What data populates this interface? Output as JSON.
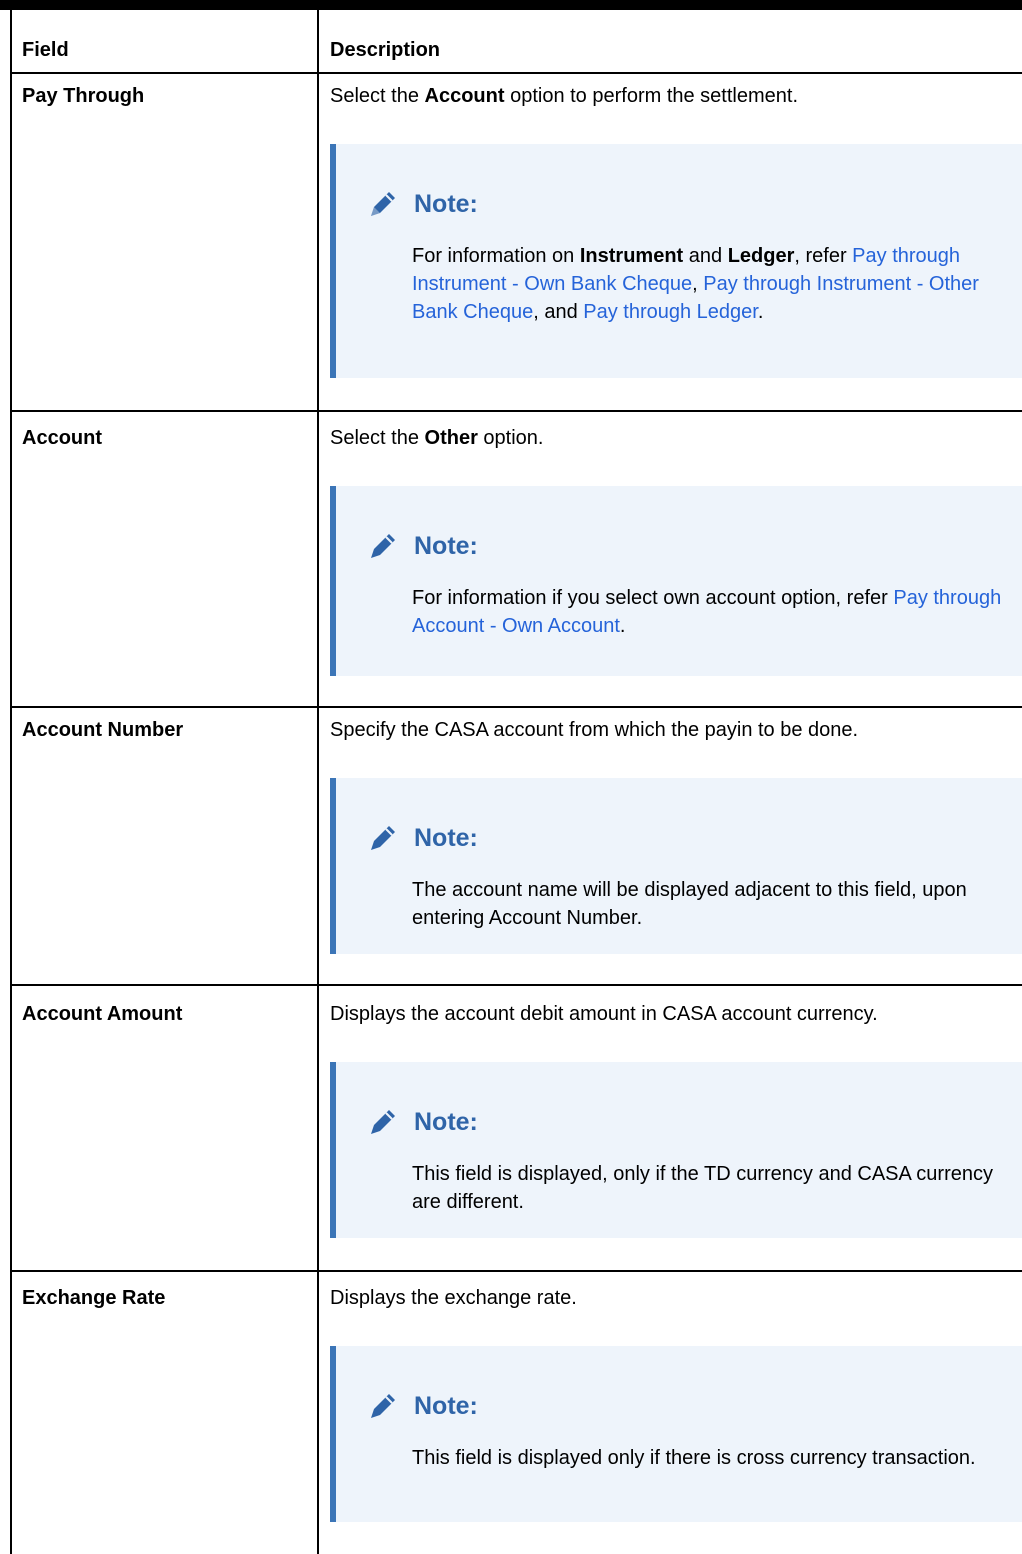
{
  "header": {
    "field": "Field",
    "description": "Description"
  },
  "note_label": "Note:",
  "rows": [
    {
      "field": "Pay Through",
      "desc_pre": "Select the ",
      "desc_bold": "Account",
      "desc_post": " option to perform the settlement.",
      "note": {
        "t1": "For information on ",
        "b1": "Instrument",
        "t2": " and ",
        "b2": "Ledger",
        "t3": ", refer ",
        "link1": "Pay through Instrument - Own Bank Cheque",
        "t4": ", ",
        "link2": "Pay through Instrument - Other Bank Cheque",
        "t5": ", and ",
        "link3": "Pay through Ledger",
        "t6": "."
      }
    },
    {
      "field": "Account",
      "desc_pre": "Select the ",
      "desc_bold": "Other",
      "desc_post": " option.",
      "note": {
        "t1": "For information if you select own account option, refer ",
        "link1": "Pay through Account - Own Account",
        "t2": "."
      }
    },
    {
      "field": "Account Number",
      "desc": "Specify the CASA account from which the payin to be done.",
      "note": {
        "text": "The account name will be displayed adjacent to this field, upon entering Account Number."
      }
    },
    {
      "field": "Account Amount",
      "desc": "Displays the account debit amount in CASA account currency.",
      "note": {
        "text": "This field is displayed, only if the TD currency and CASA currency are different."
      }
    },
    {
      "field": "Exchange Rate",
      "desc": "Displays the exchange rate.",
      "note": {
        "text": "This field is displayed only if there is cross currency transaction."
      }
    }
  ]
}
